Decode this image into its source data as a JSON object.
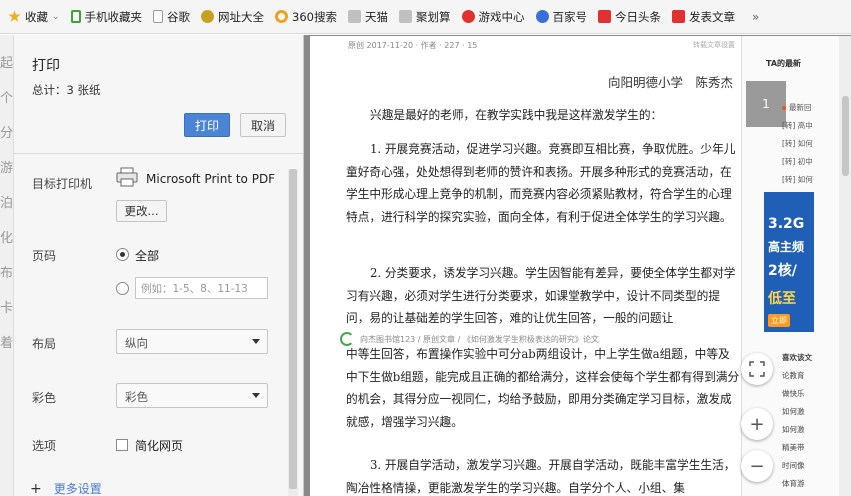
{
  "bookmarks": {
    "items": [
      {
        "label": "收藏",
        "color": "#f2b01e",
        "icon": "star-icon",
        "caret": "⌄"
      },
      {
        "label": "手机收藏夹",
        "color": "#3aa53a",
        "icon": "phone-icon"
      },
      {
        "label": "谷歌",
        "color": "#999999",
        "icon": "page-icon"
      },
      {
        "label": "网址大全",
        "color": "#c8a020",
        "icon": "globe-icon"
      },
      {
        "label": "360搜索",
        "color": "#f0a020",
        "icon": "circle-icon"
      },
      {
        "label": "天猫",
        "color": "#b0b0b0",
        "icon": "grid-icon"
      },
      {
        "label": "聚划算",
        "color": "#b0b0b0",
        "icon": "grid-icon"
      },
      {
        "label": "游戏中心",
        "color": "#e03030",
        "icon": "game-icon"
      },
      {
        "label": "百家号",
        "color": "#3b6fd8",
        "icon": "paw-icon"
      },
      {
        "label": "今日头条",
        "color": "#e03030",
        "icon": "news-icon"
      },
      {
        "label": "发表文章",
        "color": "#e03030",
        "icon": "news-icon"
      }
    ],
    "more": "»"
  },
  "edge_chars": [
    "起",
    "个",
    "分",
    "游",
    "泊",
    "化",
    "布",
    "卡",
    "着"
  ],
  "print_panel": {
    "title": "打印",
    "total": "总计：3 张纸",
    "print_button": "打印",
    "cancel_button": "取消",
    "printer_label": "目标打印机",
    "printer_name": "Microsoft Print to PDF",
    "change_button": "更改...",
    "pages_label": "页码",
    "all_option": "全部",
    "range_placeholder": "例如：1-5、8、11-13",
    "layout_label": "布局",
    "layout_value": "纵向",
    "color_label": "彩色",
    "color_value": "彩色",
    "options_label": "选项",
    "simplify_label": "简化网页",
    "more_settings": "更多设置",
    "more_plus": "+"
  },
  "preview": {
    "meta_left": "原创  2017-11-20  · 作者 ·  227  · 15",
    "meta_right": "转载文章设置",
    "author": "向阳明德小学　陈秀杰",
    "intro": "兴趣是最好的老师，在教学实践中我是这样激发学生的：",
    "p1": "1. 开展竞赛活动，促进学习兴趣。竞赛即互相比赛，争取优胜。少年儿童好奇心强，处处想得到老师的赞许和表扬。开展多种形式的竞赛活动，在学生中形成心理上竞争的机制，而竞赛内容必须紧贴教材，符合学生的心理特点，进行科学的探究实验，面向全体，有利于促进全体学生的学习兴趣。",
    "p2": "2. 分类要求，诱发学习兴趣。学生因智能有差异，要使全体学生都对学习有兴趣，必须对学生进行分类要求，如课堂教学中，设计不同类型的提问，易的让基础差的学生回答，难的让优生回答，一般的问题让",
    "inset": "向杰图书馆123 / 原创文章 / 《如何激发学生积极表达的研究》论文",
    "p3": "中等生回答，布置操作实验中可分ab两组设计，中上学生做a组题，中等及中下生做b组题，能完成且正确的都给满分，这样会使每个学生都有得到满分的机会，其得分应一视同仁，均给予鼓励，即用分类确定学习目标，激发成就感，增强学习兴趣。",
    "p4": "3. 开展自学活动，激发学习兴趣。开展自学活动，既能丰富学生生活，陶冶性格情操，更能激发学生的学习兴趣。自学分个人、小组、集"
  },
  "sidebar": {
    "title": "TA的最新",
    "page_number": "1",
    "items": [
      "最新回",
      "[转] 高中",
      "[转] 如何",
      "[转] 初中",
      "[转] 如何"
    ],
    "ad": {
      "line1": "3.2G",
      "line2": "高主频",
      "line3": "2核/",
      "line4": "低至",
      "line5": "立即"
    },
    "sub_title": "喜欢该文",
    "sub_items": [
      "论教育",
      "做快乐",
      "如何激",
      "如何激",
      "精美带",
      "时间像",
      "体育游"
    ]
  },
  "controls": {
    "zoom_in": "+",
    "zoom_out": "−"
  }
}
